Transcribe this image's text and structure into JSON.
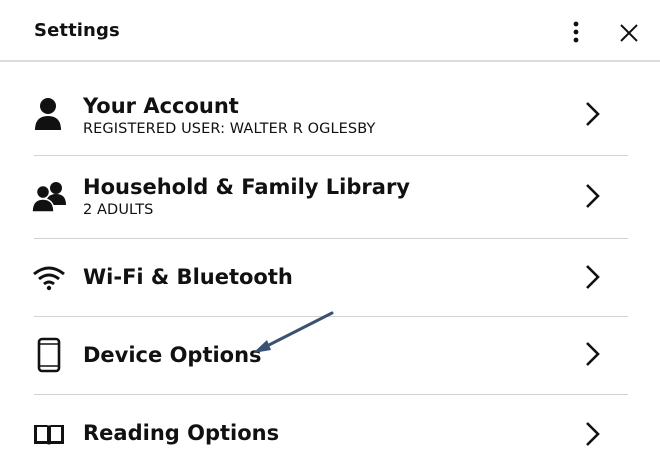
{
  "header": {
    "title": "Settings",
    "menu_icon": "more-vertical-icon",
    "close_icon": "close-icon"
  },
  "rows": [
    {
      "title": "Your Account",
      "subtitle": "REGISTERED USER: WALTER R OGLESBY",
      "icon": "person-icon"
    },
    {
      "title": "Household & Family Library",
      "subtitle": "2 ADULTS",
      "icon": "people-icon"
    },
    {
      "title": "Wi-Fi & Bluetooth",
      "icon": "wifi-icon"
    },
    {
      "title": "Device Options",
      "icon": "device-icon"
    },
    {
      "title": "Reading Options",
      "icon": "book-icon"
    }
  ],
  "annotation": {
    "icon": "annotation-arrow",
    "color": "#3a5272"
  },
  "colors": {
    "text": "#111111",
    "divider": "#d2d2d2",
    "background": "#ffffff"
  }
}
